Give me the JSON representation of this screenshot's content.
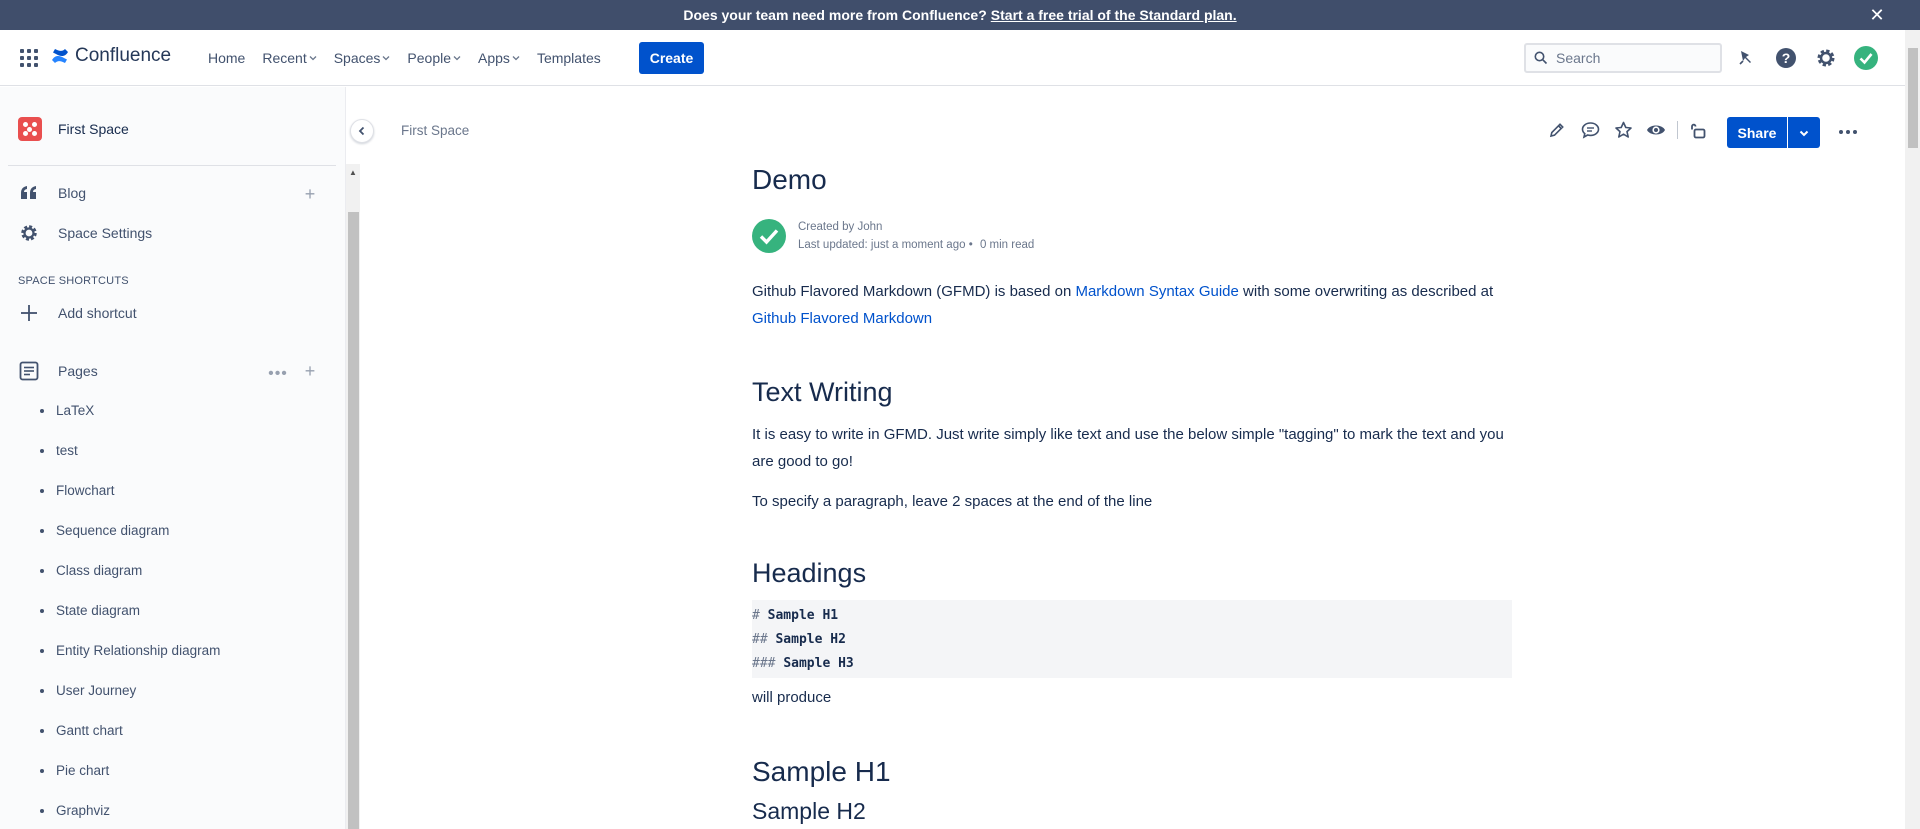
{
  "banner": {
    "text": "Does your team need more from Confluence?",
    "link": "Start a free trial of the Standard plan.",
    "close": "✕"
  },
  "nav": {
    "product": "Confluence",
    "items": [
      {
        "label": "Home",
        "has_menu": false
      },
      {
        "label": "Recent",
        "has_menu": true
      },
      {
        "label": "Spaces",
        "has_menu": true
      },
      {
        "label": "People",
        "has_menu": true
      },
      {
        "label": "Apps",
        "has_menu": true
      },
      {
        "label": "Templates",
        "has_menu": false
      }
    ],
    "create": "Create",
    "search_placeholder": "Search"
  },
  "sidebar": {
    "space_name": "First Space",
    "blog": "Blog",
    "space_settings": "Space Settings",
    "shortcuts_title": "SPACE SHORTCUTS",
    "add_shortcut": "Add shortcut",
    "pages_label": "Pages",
    "pages": [
      "LaTeX",
      "test",
      "Flowchart",
      "Sequence diagram",
      "Class diagram",
      "State diagram",
      "Entity Relationship diagram",
      "User Journey",
      "Gantt chart",
      "Pie chart",
      "Graphviz"
    ]
  },
  "page": {
    "breadcrumb": "First Space",
    "share": "Share",
    "title": "Demo",
    "created_by": "Created by John",
    "last_updated": "Last updated: just a moment ago",
    "read_time": "0 min read",
    "intro_before": "Github Flavored Markdown (GFMD) is based on ",
    "intro_link1": "Markdown Syntax Guide",
    "intro_middle": " with some overwriting as described at ",
    "intro_link2": "Github Flavored Markdown",
    "section1_title": "Text Writing",
    "section1_p1": "It is easy to write in GFMD. Just write simply like text and use the below simple \"tagging\" to mark the text and you are good to go!",
    "section1_p2": "To specify a paragraph, leave 2 spaces at the end of the line",
    "section2_title": "Headings",
    "code_lines": [
      {
        "hash": "#",
        "text": "Sample H1"
      },
      {
        "hash": "##",
        "text": "Sample H2"
      },
      {
        "hash": "###",
        "text": "Sample H3"
      }
    ],
    "will_produce": "will produce",
    "sample_h1": "Sample H1",
    "sample_h2": "Sample H2"
  },
  "colors": {
    "brand": "#0052cc",
    "banner": "#404e6b",
    "success": "#36b37e",
    "text": "#172b4d"
  }
}
